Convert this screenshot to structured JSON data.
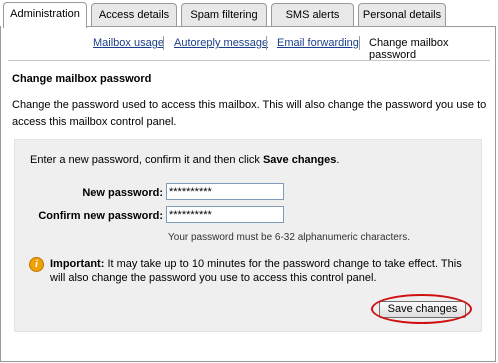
{
  "tabs": [
    "Administration",
    "Access details",
    "Spam filtering",
    "SMS alerts",
    "Personal details"
  ],
  "subnav": {
    "mailbox_usage": "Mailbox usage",
    "autoreply": "Autoreply message",
    "forwarding": "Email forwarding",
    "current": "Change mailbox password"
  },
  "section": {
    "title": "Change mailbox password",
    "description": "Change the password used to access this mailbox. This will also change the password you use to access this mailbox control panel."
  },
  "form": {
    "intro_text": "Enter a new password, confirm it and then click",
    "intro_bold": "Save changes",
    "intro_end": ".",
    "new_password_label": "New password:",
    "new_password_value": "**********",
    "confirm_password_label": "Confirm new password:",
    "confirm_password_value": "**********",
    "hint": "Your password must be 6-32 alphanumeric characters.",
    "important_label": "Important:",
    "important_text": "It may take up to 10 minutes for the password change to take effect. This will also change the password you use to access this control panel.",
    "save_button": "Save changes"
  },
  "colors": {
    "link": "#1a3f8a",
    "highlight_circle": "#d01010",
    "warning_icon": "#f0a000"
  }
}
